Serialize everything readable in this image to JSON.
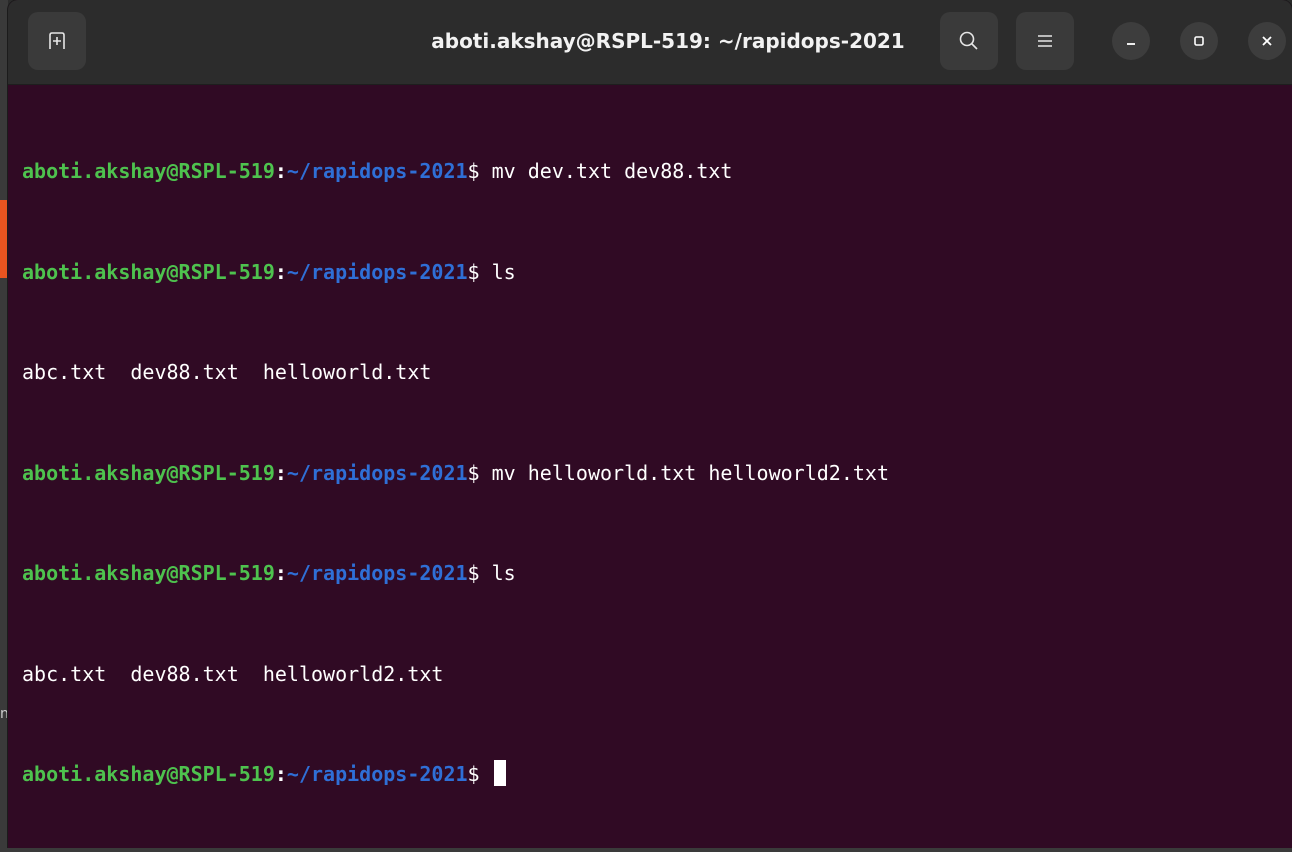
{
  "window": {
    "title": "aboti.akshay@RSPL-519: ~/rapidops-2021"
  },
  "side": {
    "glyph": "n"
  },
  "colors": {
    "terminal_bg": "#300a24",
    "titlebar_bg": "#2c2c2c",
    "prompt_user": "#4ec24e",
    "prompt_path": "#2f6fd6",
    "text": "#ffffff",
    "accent": "#e95420"
  },
  "icons": {
    "new_tab": "new-tab-icon",
    "search": "search-icon",
    "menu": "hamburger-menu-icon",
    "minimize": "minimize-icon",
    "maximize": "maximize-icon",
    "close": "close-icon"
  },
  "terminal": {
    "lines": [
      {
        "type": "prompt",
        "user": "aboti.akshay@RSPL-519",
        "colon": ":",
        "path": "~/rapidops-2021",
        "dollar": "$ ",
        "command": "mv dev.txt dev88.txt"
      },
      {
        "type": "prompt",
        "user": "aboti.akshay@RSPL-519",
        "colon": ":",
        "path": "~/rapidops-2021",
        "dollar": "$ ",
        "command": "ls"
      },
      {
        "type": "output",
        "text": "abc.txt  dev88.txt  helloworld.txt"
      },
      {
        "type": "prompt",
        "user": "aboti.akshay@RSPL-519",
        "colon": ":",
        "path": "~/rapidops-2021",
        "dollar": "$ ",
        "command": "mv helloworld.txt helloworld2.txt"
      },
      {
        "type": "prompt",
        "user": "aboti.akshay@RSPL-519",
        "colon": ":",
        "path": "~/rapidops-2021",
        "dollar": "$ ",
        "command": "ls"
      },
      {
        "type": "output",
        "text": "abc.txt  dev88.txt  helloworld2.txt"
      },
      {
        "type": "prompt",
        "user": "aboti.akshay@RSPL-519",
        "colon": ":",
        "path": "~/rapidops-2021",
        "dollar": "$ ",
        "command": ""
      }
    ]
  }
}
